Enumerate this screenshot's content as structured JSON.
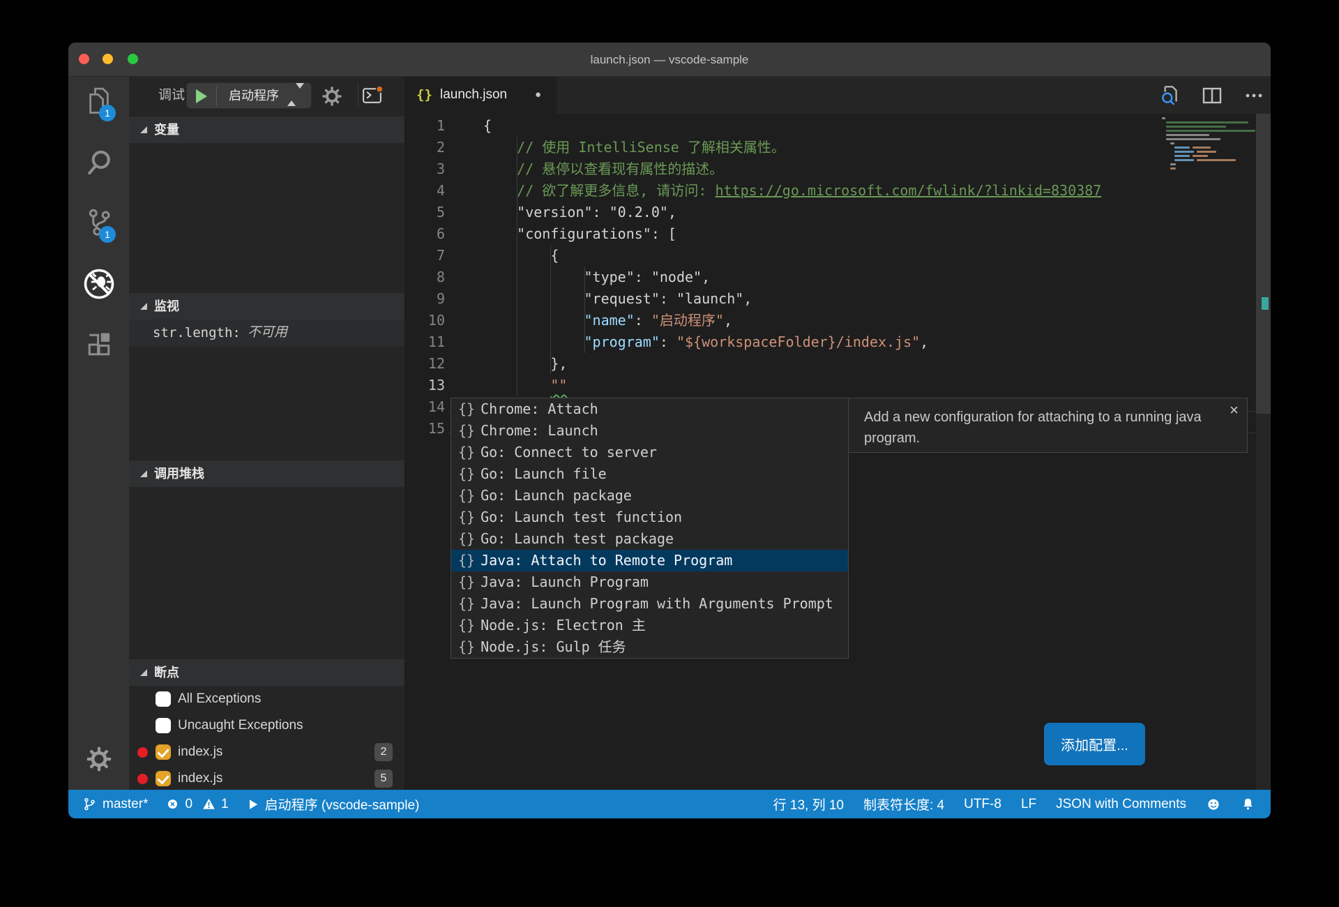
{
  "window": {
    "title": "launch.json — vscode-sample"
  },
  "colors": {
    "accent": "#1680c9",
    "button_blue": "#1173bb",
    "badge_blue": "#1d8bd8",
    "list_selection": "#04395e",
    "comment_green": "#6a9955",
    "string_orange": "#ce9178",
    "key_blue": "#9cdcfe",
    "breakpoint_red": "#e51e25",
    "checkbox_orange": "#e2a327",
    "squiggle_green": "#58a65c",
    "traffic_close": "#ff5f57",
    "traffic_minimize": "#febc2e",
    "traffic_zoom": "#28c840"
  },
  "activity_bar": {
    "explorer_badge": "1",
    "source_control_badge": "1",
    "items": [
      "explorer",
      "search",
      "source-control",
      "debug",
      "extensions"
    ],
    "active_item": "debug",
    "bottom_items": [
      "settings"
    ]
  },
  "debug_toolbar": {
    "view_label": "调试",
    "config_name": "启动程序"
  },
  "sidebar": {
    "variables_title": "变量",
    "watch_title": "监视",
    "watch_rows": [
      {
        "expr": "str.length:",
        "value": "不可用"
      }
    ],
    "call_stack_title": "调用堆栈",
    "breakpoints_title": "断点",
    "breakpoints": [
      {
        "label": "All Exceptions",
        "checked": false,
        "dot": false,
        "badge": ""
      },
      {
        "label": "Uncaught Exceptions",
        "checked": false,
        "dot": false,
        "badge": ""
      },
      {
        "label": "index.js",
        "checked": true,
        "dot": true,
        "badge": "2"
      },
      {
        "label": "index.js",
        "checked": true,
        "dot": true,
        "badge": "5"
      }
    ]
  },
  "editor": {
    "tab": {
      "icon": "{}",
      "label": "launch.json",
      "modified_dot": "●"
    },
    "code_lines": [
      {
        "tokens": [
          [
            "plain",
            "{"
          ]
        ]
      },
      {
        "tokens": [
          [
            "comment",
            "    // 使用 IntelliSense 了解相关属性。"
          ]
        ]
      },
      {
        "tokens": [
          [
            "comment",
            "    // 悬停以查看现有属性的描述。"
          ]
        ]
      },
      {
        "tokens": [
          [
            "comment",
            "    // 欲了解更多信息, 请访问: "
          ],
          [
            "link",
            "https://go.microsoft.com/fwlink/?linkid=830387"
          ]
        ]
      },
      {
        "tokens": [
          [
            "plain",
            "    \"version\": \"0.2.0\","
          ]
        ]
      },
      {
        "tokens": [
          [
            "plain",
            "    \"configurations\": ["
          ]
        ]
      },
      {
        "tokens": [
          [
            "plain",
            "        {"
          ]
        ]
      },
      {
        "tokens": [
          [
            "plain",
            "            \"type\": \"node\","
          ]
        ]
      },
      {
        "tokens": [
          [
            "plain",
            "            \"request\": \"launch\","
          ]
        ]
      },
      {
        "tokens": [
          [
            "plain",
            "            "
          ],
          [
            "key",
            "\"name\""
          ],
          [
            "plain",
            ": "
          ],
          [
            "string",
            "\"启动程序\""
          ],
          [
            "plain",
            ","
          ]
        ]
      },
      {
        "tokens": [
          [
            "plain",
            "            "
          ],
          [
            "key",
            "\"program\""
          ],
          [
            "plain",
            ": "
          ],
          [
            "string",
            "\"${workspaceFolder}/index.js\""
          ],
          [
            "plain",
            ","
          ]
        ]
      },
      {
        "tokens": [
          [
            "plain",
            "        },"
          ]
        ]
      },
      {
        "tokens": [
          [
            "plain",
            "        "
          ],
          [
            "squiggle",
            "\"\""
          ]
        ]
      },
      {
        "tokens": []
      },
      {
        "tokens": []
      }
    ],
    "active_line_number": 13,
    "suggest": {
      "items": [
        "Chrome: Attach",
        "Chrome: Launch",
        "Go: Connect to server",
        "Go: Launch file",
        "Go: Launch package",
        "Go: Launch test function",
        "Go: Launch test package",
        "Java: Attach to Remote Program",
        "Java: Launch Program",
        "Java: Launch Program with Arguments Prompt",
        "Node.js: Electron 主",
        "Node.js: Gulp 任务"
      ],
      "selected_index": 7,
      "item_icon": "{}",
      "doc_text": "Add a new configuration for attaching to a running java program.",
      "doc_close": "×"
    },
    "add_config_button": "添加配置...",
    "minimap_rows": [
      [
        [
          0,
          5,
          "grey"
        ]
      ],
      [
        [
          6,
          118,
          "green"
        ]
      ],
      [
        [
          6,
          86,
          "green"
        ]
      ],
      [
        [
          6,
          128,
          "green"
        ]
      ],
      [
        [
          6,
          62,
          "grey"
        ]
      ],
      [
        [
          6,
          78,
          "grey"
        ]
      ],
      [
        [
          12,
          6,
          "grey"
        ]
      ],
      [
        [
          18,
          22,
          "blue"
        ],
        [
          44,
          26,
          "orange"
        ]
      ],
      [
        [
          18,
          28,
          "blue"
        ],
        [
          50,
          28,
          "orange"
        ]
      ],
      [
        [
          18,
          22,
          "blue"
        ],
        [
          44,
          22,
          "orange"
        ]
      ],
      [
        [
          18,
          28,
          "blue"
        ],
        [
          50,
          56,
          "orange"
        ]
      ],
      [
        [
          12,
          8,
          "grey"
        ]
      ],
      [
        [
          12,
          8,
          "orange"
        ]
      ]
    ]
  },
  "status_bar": {
    "branch": "master*",
    "errors": "0",
    "warnings": "1",
    "run_config": "启动程序 (vscode-sample)",
    "line_col": "行 13, 列 10",
    "indent": "制表符长度: 4",
    "encoding": "UTF-8",
    "eol": "LF",
    "language": "JSON with Comments"
  }
}
